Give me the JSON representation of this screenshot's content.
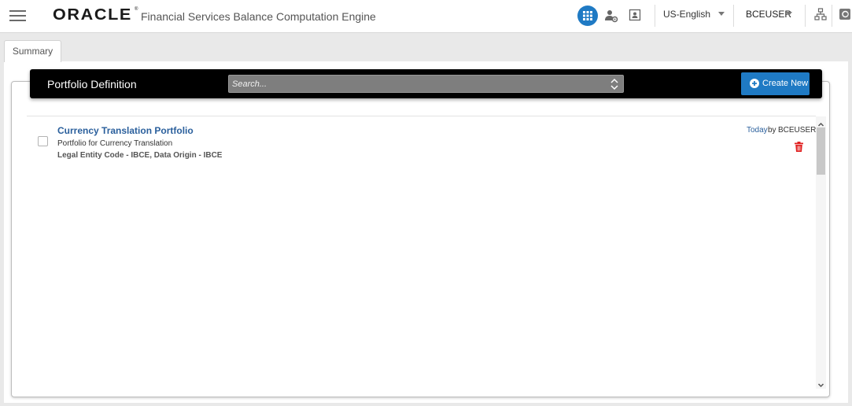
{
  "header": {
    "logo_text": "ORACLE",
    "logo_mark": "®",
    "app_title": "Financial Services Balance Computation Engine",
    "language": "US-English",
    "user": "BCEUSER",
    "icons": [
      "menu-icon",
      "apps-grid-icon",
      "user-settings-icon",
      "contact-card-icon",
      "hierarchy-icon",
      "about-icon"
    ]
  },
  "tabs": [
    {
      "label": "Summary",
      "active": true
    }
  ],
  "toolbar": {
    "title": "Portfolio Definition",
    "search_placeholder": "Search...",
    "create_label": "Create New"
  },
  "items": [
    {
      "title": "Currency Translation Portfolio",
      "description": "Portfolio for Currency Translation",
      "meta": "Legal Entity Code - IBCE, Data Origin - IBCE",
      "date": "Today",
      "by": "by",
      "user": "BCEUSER"
    }
  ],
  "colors": {
    "accent": "#1f7ac4",
    "link": "#2a5f9c",
    "toolbar_bg": "#000000",
    "delete": "#e02020"
  }
}
